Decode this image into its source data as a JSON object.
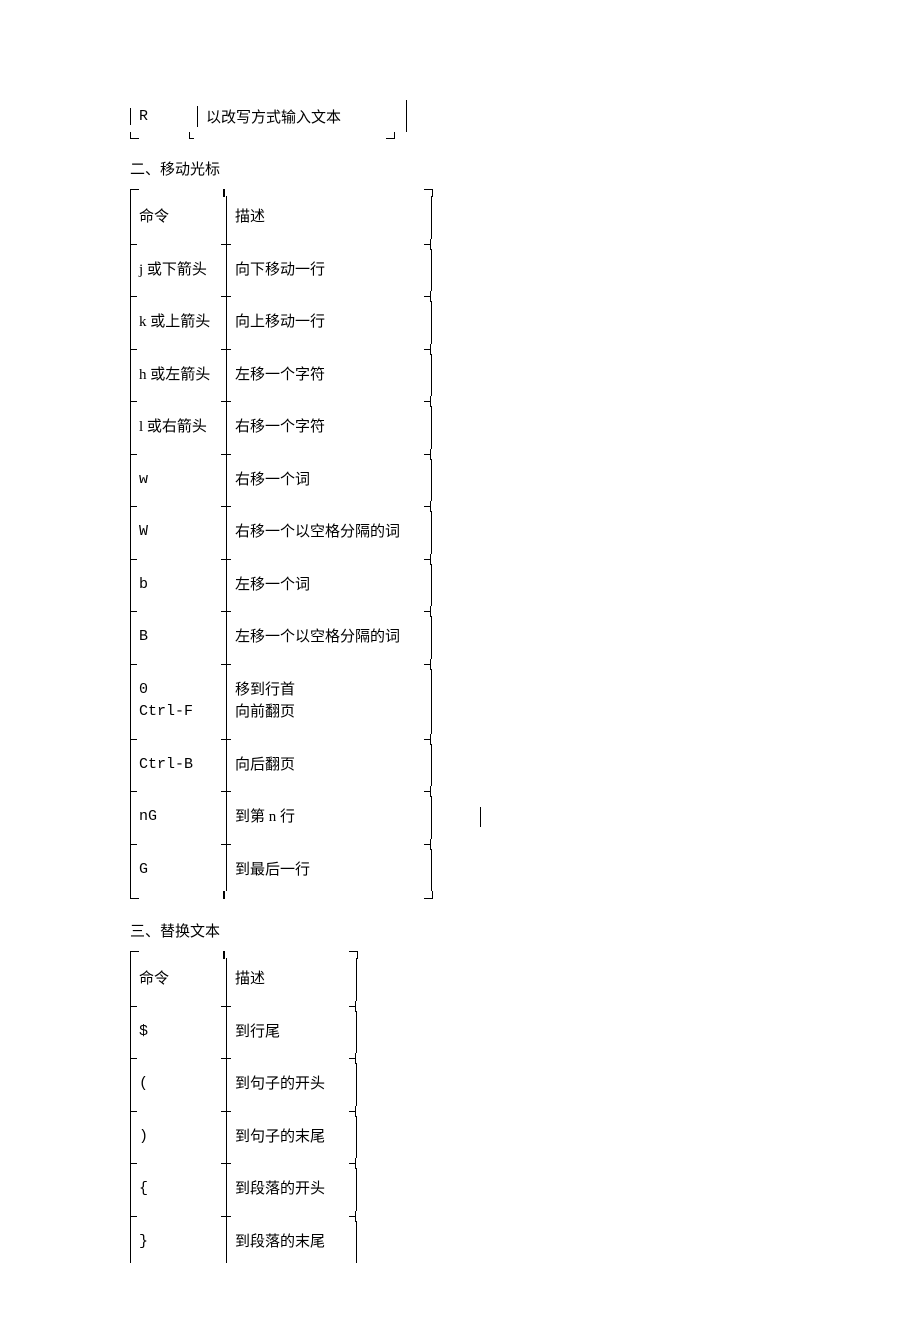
{
  "fragment_table": {
    "row": {
      "cmd": "R",
      "desc": "以改写方式输入文本"
    }
  },
  "section2": {
    "title": "二、移动光标",
    "headers": {
      "cmd": "命令",
      "desc": "描述"
    },
    "rows": [
      {
        "cmd": "j 或下箭头",
        "desc": "向下移动一行"
      },
      {
        "cmd": "k 或上箭头",
        "desc": "向上移动一行"
      },
      {
        "cmd": "h 或左箭头",
        "desc": "左移一个字符"
      },
      {
        "cmd": "l 或右箭头",
        "desc": "右移一个字符"
      },
      {
        "cmd": "w",
        "desc": "右移一个词"
      },
      {
        "cmd": "W",
        "desc": "右移一个以空格分隔的词"
      },
      {
        "cmd": "b",
        "desc": "左移一个词"
      },
      {
        "cmd": "B",
        "desc": "左移一个以空格分隔的词"
      },
      {
        "cmd": "0\nCtrl-F",
        "desc": "移到行首\n向前翻页"
      },
      {
        "cmd": "Ctrl-B",
        "desc": "向后翻页"
      },
      {
        "cmd": "nG",
        "desc": "到第 n 行"
      },
      {
        "cmd": "G",
        "desc": "到最后一行"
      }
    ]
  },
  "section3": {
    "title": "三、替换文本",
    "headers": {
      "cmd": "命令",
      "desc": "描述"
    },
    "rows": [
      {
        "cmd": "$",
        "desc": "到行尾"
      },
      {
        "cmd": "(",
        "desc": "到句子的开头"
      },
      {
        "cmd": ")",
        "desc": "到句子的末尾"
      },
      {
        "cmd": "{",
        "desc": "到段落的开头"
      },
      {
        "cmd": "}",
        "desc": "到段落的末尾"
      }
    ]
  }
}
